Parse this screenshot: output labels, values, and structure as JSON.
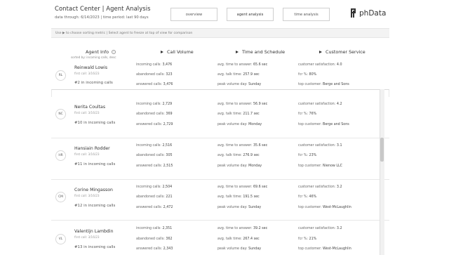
{
  "header": {
    "title": "Contact Center | Agent Analysis",
    "subtitle": "data through: 6/14/2023 | time period: last 90 days",
    "nav": [
      {
        "label": "overview",
        "active": false
      },
      {
        "label": "agent analysis",
        "active": true
      },
      {
        "label": "time analysis",
        "active": false
      }
    ],
    "logo_text": "phData"
  },
  "hint": "Use ▶ to choose sorting metric | Select agent to freeze at top of view for comparison",
  "columns": {
    "agent_info": "Agent Info",
    "agent_info_sub": "sorted by: incoming calls, desc",
    "call_volume": "Call Volume",
    "time_schedule": "Time and Schedule",
    "customer_service": "Customer Service"
  },
  "labels": {
    "incoming": "incoming calls:",
    "abandoned": "abandoned calls:",
    "answered": "answered calls:",
    "avg_answer": "avg. time to answer:",
    "avg_talk": "avg. talk time:",
    "peak_day": "peak volume day:",
    "satisfaction": "customer satisfaction:",
    "fcr": "fcr %:",
    "top_customer": "top customer:"
  },
  "frozen_agent": {
    "initials": "RL",
    "name": "Reinwald Lowis",
    "first_call": "first call: 3/16/23",
    "rank": "#2 in incoming calls",
    "incoming": "3,476",
    "abandoned": "323",
    "answered": "3,476",
    "avg_answer": "65.6 sec",
    "avg_talk": "257.9 sec",
    "peak_day": "Sunday",
    "satisfaction": "4.0",
    "fcr": "80%",
    "top_customer": "Berge and Sons"
  },
  "agents": [
    {
      "initials": "NC",
      "name": "Nerita Coultas",
      "first_call": "first call: 3/16/23",
      "rank": "#10 in incoming calls",
      "incoming": "2,729",
      "abandoned": "369",
      "answered": "2,729",
      "avg_answer": "56.9 sec",
      "avg_talk": "211.7 sec",
      "peak_day": "Monday",
      "satisfaction": "4.2",
      "fcr": "76%",
      "top_customer": "Berge and Sons"
    },
    {
      "initials": "HR",
      "name": "Hansiain Rodder",
      "first_call": "first call: 3/16/23",
      "rank": "#11 in incoming calls",
      "incoming": "2,516",
      "abandoned": "305",
      "answered": "2,515",
      "avg_answer": "35.6 sec",
      "avg_talk": "276.9 sec",
      "peak_day": "Monday",
      "satisfaction": "3.1",
      "fcr": "23%",
      "top_customer": "Nienow LLC"
    },
    {
      "initials": "CM",
      "name": "Corine Mingasson",
      "first_call": "first call: 3/16/23",
      "rank": "#12 in incoming calls",
      "incoming": "2,504",
      "abandoned": "221",
      "answered": "2,472",
      "avg_answer": "69.6 sec",
      "avg_talk": "191.5 sec",
      "peak_day": "Sunday",
      "satisfaction": "3.2",
      "fcr": "46%",
      "top_customer": "West-McLaughlin"
    },
    {
      "initials": "VL",
      "name": "Valentijn Lambdin",
      "first_call": "first call: 3/16/23",
      "rank": "#13 in incoming calls",
      "incoming": "2,351",
      "abandoned": "362",
      "answered": "2,343",
      "avg_answer": "39.2 sec",
      "avg_talk": "267.4 sec",
      "peak_day": "Sunday",
      "satisfaction": "3.2",
      "fcr": "21%",
      "top_customer": "West-McLaughlin"
    }
  ]
}
